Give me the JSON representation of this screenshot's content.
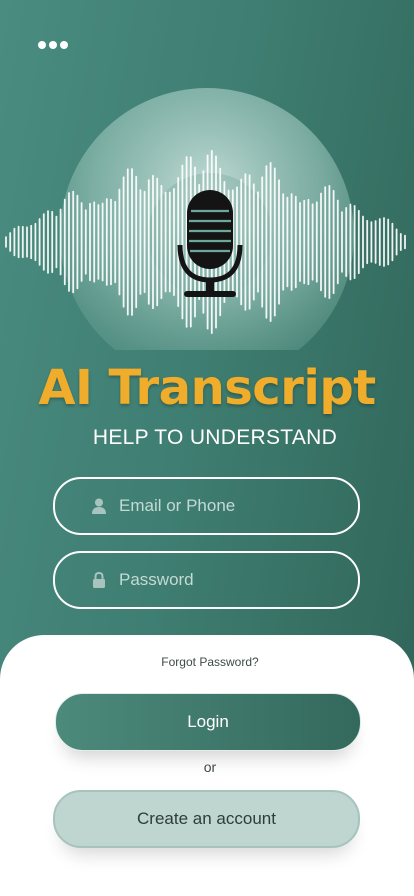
{
  "menu": {
    "icon": "more-dots-icon"
  },
  "hero": {
    "icon": "microphone-icon",
    "decoration": "soundwave"
  },
  "app": {
    "title": "AI Transcript",
    "subtitle": "HELP TO UNDERSTAND"
  },
  "form": {
    "email": {
      "placeholder": "Email or Phone",
      "value": "",
      "icon": "user-icon"
    },
    "password": {
      "placeholder": "Password",
      "value": "",
      "icon": "lock-icon"
    },
    "forgot_label": "Forgot Password?",
    "login_label": "Login",
    "or_label": "or",
    "create_label": "Create an account"
  },
  "colors": {
    "background": "#3f7e72",
    "accent": "#f0ad2b",
    "login_button": "#34695d",
    "create_button": "#bed5d0"
  }
}
